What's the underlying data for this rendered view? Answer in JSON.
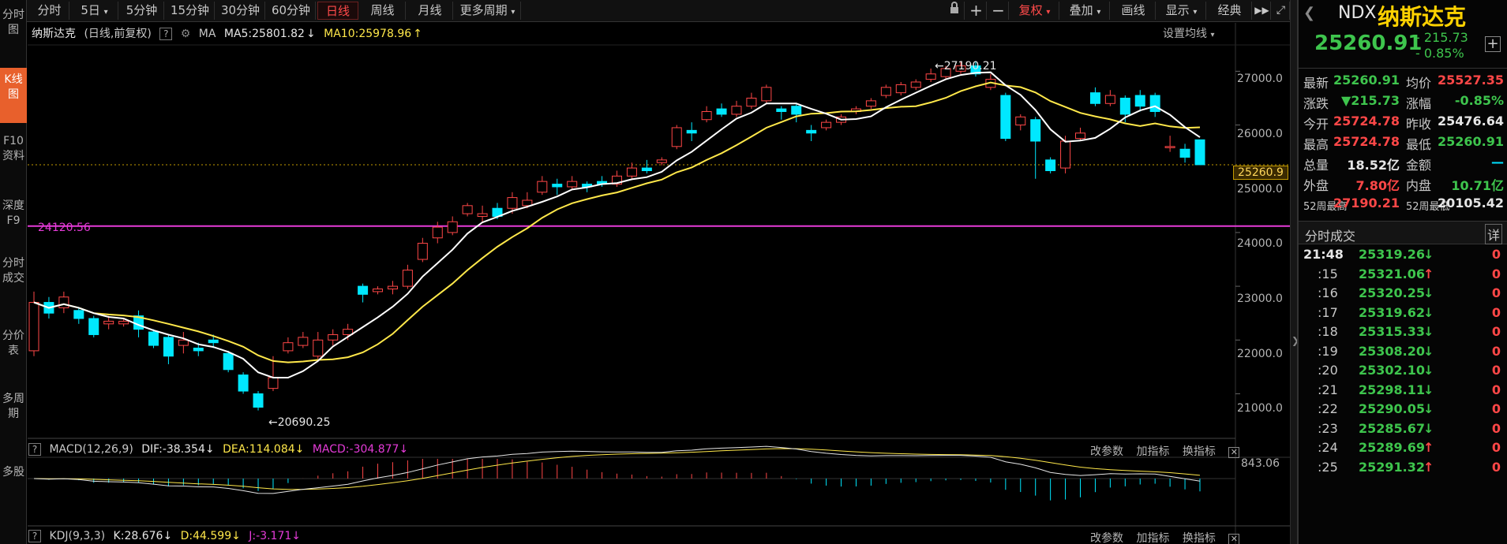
{
  "leftbar": {
    "tabs": [
      {
        "label": "分时图",
        "active": false
      },
      {
        "label": "K线图",
        "active": true
      },
      {
        "label": "F10资料",
        "active": false
      },
      {
        "label": "深度F9",
        "active": false
      },
      {
        "label": "分时成交",
        "active": false
      },
      {
        "label": "分价表",
        "active": false
      },
      {
        "label": "多周期",
        "active": false
      },
      {
        "label": "多股",
        "active": false
      }
    ]
  },
  "toolbar": {
    "periods": [
      "分时",
      "5日",
      "5分钟",
      "15分钟",
      "30分钟",
      "60分钟",
      "日线",
      "周线",
      "月线",
      "更多周期"
    ],
    "active_period": "日线",
    "right": [
      "复权",
      "叠加",
      "画线",
      "显示",
      "经典"
    ],
    "icons": [
      "lock-icon",
      "plus-icon",
      "minus-icon",
      "fast-forward-icon",
      "fullscreen-icon"
    ]
  },
  "chart": {
    "name": "纳斯达克",
    "mode": "(日线,前复权)",
    "ma_label": "MA",
    "ma5": "MA5:25801.82",
    "ma10": "MA10:25978.96",
    "set_ma": "设置均线",
    "high_label": "27190.21",
    "low_label": "20690.25",
    "hline_label": "24120.56",
    "last_price_tag": "25260.9",
    "y_ticks": [
      "27000.0",
      "26000.0",
      "25000.0",
      "24000.0",
      "23000.0",
      "22000.0",
      "21000.0"
    ]
  },
  "chart_data": {
    "type": "candlestick",
    "ylim": [
      20200,
      27900
    ],
    "hline": 24120.56,
    "candles": [
      [
        21800,
        22700,
        22900,
        21700
      ],
      [
        22700,
        22500,
        22800,
        22400
      ],
      [
        22600,
        22800,
        22900,
        22500
      ],
      [
        22550,
        22400,
        22600,
        22300
      ],
      [
        22400,
        22100,
        22450,
        22050
      ],
      [
        22300,
        22350,
        22450,
        22200
      ],
      [
        22300,
        22350,
        22400,
        22250
      ],
      [
        22450,
        22200,
        22550,
        22050
      ],
      [
        22150,
        21900,
        22200,
        21850
      ],
      [
        22050,
        21700,
        22100,
        21550
      ],
      [
        21900,
        22000,
        22150,
        21750
      ],
      [
        21850,
        21800,
        21950,
        21700
      ],
      [
        22000,
        21950,
        22100,
        21850
      ],
      [
        21750,
        21450,
        21800,
        21400
      ],
      [
        21350,
        21050,
        21400,
        21000
      ],
      [
        21000,
        20750,
        21050,
        20690
      ],
      [
        21100,
        21300,
        21700,
        21050
      ],
      [
        21800,
        21950,
        22050,
        21750
      ],
      [
        21900,
        22050,
        22150,
        21850
      ],
      [
        21700,
        22000,
        22150,
        21650
      ],
      [
        22000,
        22100,
        22200,
        21900
      ],
      [
        22100,
        22200,
        22300,
        22000
      ],
      [
        23000,
        22850,
        23050,
        22700
      ],
      [
        22900,
        22950,
        23000,
        22850
      ],
      [
        22950,
        23000,
        23100,
        22850
      ],
      [
        23000,
        23300,
        23400,
        22950
      ],
      [
        23500,
        23800,
        23900,
        23450
      ],
      [
        23900,
        24100,
        24200,
        23800
      ],
      [
        24000,
        24200,
        24300,
        23950
      ],
      [
        24350,
        24500,
        24550,
        24300
      ],
      [
        24300,
        24350,
        24500,
        24200
      ],
      [
        24450,
        24300,
        24550,
        24250
      ],
      [
        24450,
        24650,
        24750,
        24350
      ],
      [
        24500,
        24600,
        24750,
        24450
      ],
      [
        24750,
        24950,
        25050,
        24700
      ],
      [
        24900,
        24850,
        25000,
        24700
      ],
      [
        24850,
        24950,
        25050,
        24800
      ],
      [
        24900,
        24850,
        24950,
        24750
      ],
      [
        24950,
        24900,
        25050,
        24850
      ],
      [
        24900,
        25050,
        25150,
        24850
      ],
      [
        25050,
        25200,
        25300,
        25000
      ],
      [
        25200,
        25150,
        25350,
        25100
      ],
      [
        25300,
        25350,
        25400,
        25250
      ],
      [
        25600,
        25950,
        26000,
        25550
      ],
      [
        25900,
        25850,
        26050,
        25700
      ],
      [
        26100,
        26250,
        26350,
        26050
      ],
      [
        26300,
        26200,
        26400,
        26150
      ],
      [
        26200,
        26350,
        26450,
        26150
      ],
      [
        26350,
        26500,
        26600,
        26300
      ],
      [
        26450,
        26700,
        26750,
        26400
      ],
      [
        26300,
        26250,
        26350,
        26100
      ],
      [
        26350,
        26200,
        26400,
        26050
      ],
      [
        25900,
        25850,
        26000,
        25700
      ],
      [
        25950,
        26050,
        26100,
        25900
      ],
      [
        26050,
        26150,
        26200,
        26000
      ],
      [
        26250,
        26300,
        26350,
        26200
      ],
      [
        26350,
        26450,
        26500,
        26300
      ],
      [
        26550,
        26700,
        26750,
        26500
      ],
      [
        26600,
        26750,
        26800,
        26550
      ],
      [
        26700,
        26800,
        26850,
        26650
      ],
      [
        26850,
        26950,
        27050,
        26800
      ],
      [
        26900,
        27050,
        27100,
        26850
      ],
      [
        27000,
        27100,
        27190.21,
        26950
      ],
      [
        27100,
        26950,
        27190,
        26900
      ],
      [
        26700,
        26850,
        26950,
        26650
      ],
      [
        26550,
        25750,
        26600,
        25700
      ],
      [
        26000,
        26150,
        26200,
        25900
      ],
      [
        26100,
        25700,
        26150,
        25000
      ],
      [
        25350,
        25150,
        25400,
        25100
      ],
      [
        25200,
        25700,
        25800,
        25100
      ],
      [
        25750,
        25850,
        25950,
        25700
      ],
      [
        26600,
        26400,
        26700,
        26350
      ],
      [
        26400,
        26550,
        26650,
        26350
      ],
      [
        26500,
        26200,
        26550,
        26050
      ],
      [
        26550,
        26350,
        26650,
        26250
      ],
      [
        26550,
        26250,
        26600,
        26150
      ],
      [
        25600,
        25600,
        25800,
        25500
      ],
      [
        25550,
        25400,
        25650,
        25300
      ],
      [
        25724.78,
        25260.91,
        25724.78,
        25260.91
      ]
    ],
    "macd": {
      "DIF": -38.354,
      "DEA": 114.084,
      "MACD": -304.877,
      "top_label": "843.06"
    }
  },
  "macd": {
    "title": "MACD(12,26,9)",
    "dif": "DIF:-38.354",
    "dea": "DEA:114.084",
    "macd": "MACD:-304.877",
    "top_value": "843.06",
    "tools": [
      "改参数",
      "加指标",
      "换指标"
    ]
  },
  "kdj": {
    "title": "KDJ(9,3,3)",
    "k": "K:28.676",
    "d": "D:44.599",
    "j": "J:-3.171",
    "tools": [
      "改参数",
      "加指标",
      "换指标"
    ]
  },
  "panel": {
    "code": "NDX",
    "name": "纳斯达克",
    "price": "25260.91",
    "change": "- 215.73",
    "change_pct": "- 0.85%",
    "stats": [
      {
        "l1": "最新",
        "v1": "25260.91",
        "c1": "green",
        "l2": "均价",
        "v2": "25527.35",
        "c2": "red"
      },
      {
        "l1": "涨跌",
        "v1": "▼215.73",
        "c1": "green",
        "l2": "涨幅",
        "v2": "-0.85%",
        "c2": "green"
      },
      {
        "l1": "今开",
        "v1": "25724.78",
        "c1": "red",
        "l2": "昨收",
        "v2": "25476.64",
        "c2": "white"
      },
      {
        "l1": "最高",
        "v1": "25724.78",
        "c1": "red",
        "l2": "最低",
        "v2": "25260.91",
        "c2": "green"
      },
      {
        "l1": "总量",
        "v1": "18.52亿",
        "c1": "white",
        "l2": "金额",
        "v2": "—",
        "c2": "cyan"
      },
      {
        "l1": "外盘",
        "v1": "7.80亿",
        "c1": "red",
        "l2": "内盘",
        "v2": "10.71亿",
        "c2": "green"
      },
      {
        "l1": "52周最高",
        "v1": "27190.21",
        "c1": "red",
        "l2": "52周最低",
        "v2": "20105.42",
        "c2": "white"
      }
    ],
    "trades_title": "分时成交",
    "trades_btn": "详",
    "trades": [
      {
        "t": "21:48",
        "p": "25319.26",
        "dir": "↓",
        "v": "0"
      },
      {
        "t": ":15",
        "p": "25321.06",
        "dir": "↑",
        "v": "0"
      },
      {
        "t": ":16",
        "p": "25320.25",
        "dir": "↓",
        "v": "0"
      },
      {
        "t": ":17",
        "p": "25319.62",
        "dir": "↓",
        "v": "0"
      },
      {
        "t": ":18",
        "p": "25315.33",
        "dir": "↓",
        "v": "0"
      },
      {
        "t": ":19",
        "p": "25308.20",
        "dir": "↓",
        "v": "0"
      },
      {
        "t": ":20",
        "p": "25302.10",
        "dir": "↓",
        "v": "0"
      },
      {
        "t": ":21",
        "p": "25298.11",
        "dir": "↓",
        "v": "0"
      },
      {
        "t": ":22",
        "p": "25290.05",
        "dir": "↓",
        "v": "0"
      },
      {
        "t": ":23",
        "p": "25285.67",
        "dir": "↓",
        "v": "0"
      },
      {
        "t": ":24",
        "p": "25289.69",
        "dir": "↑",
        "v": "0"
      },
      {
        "t": ":25",
        "p": "25291.32",
        "dir": "↑",
        "v": "0"
      }
    ]
  }
}
